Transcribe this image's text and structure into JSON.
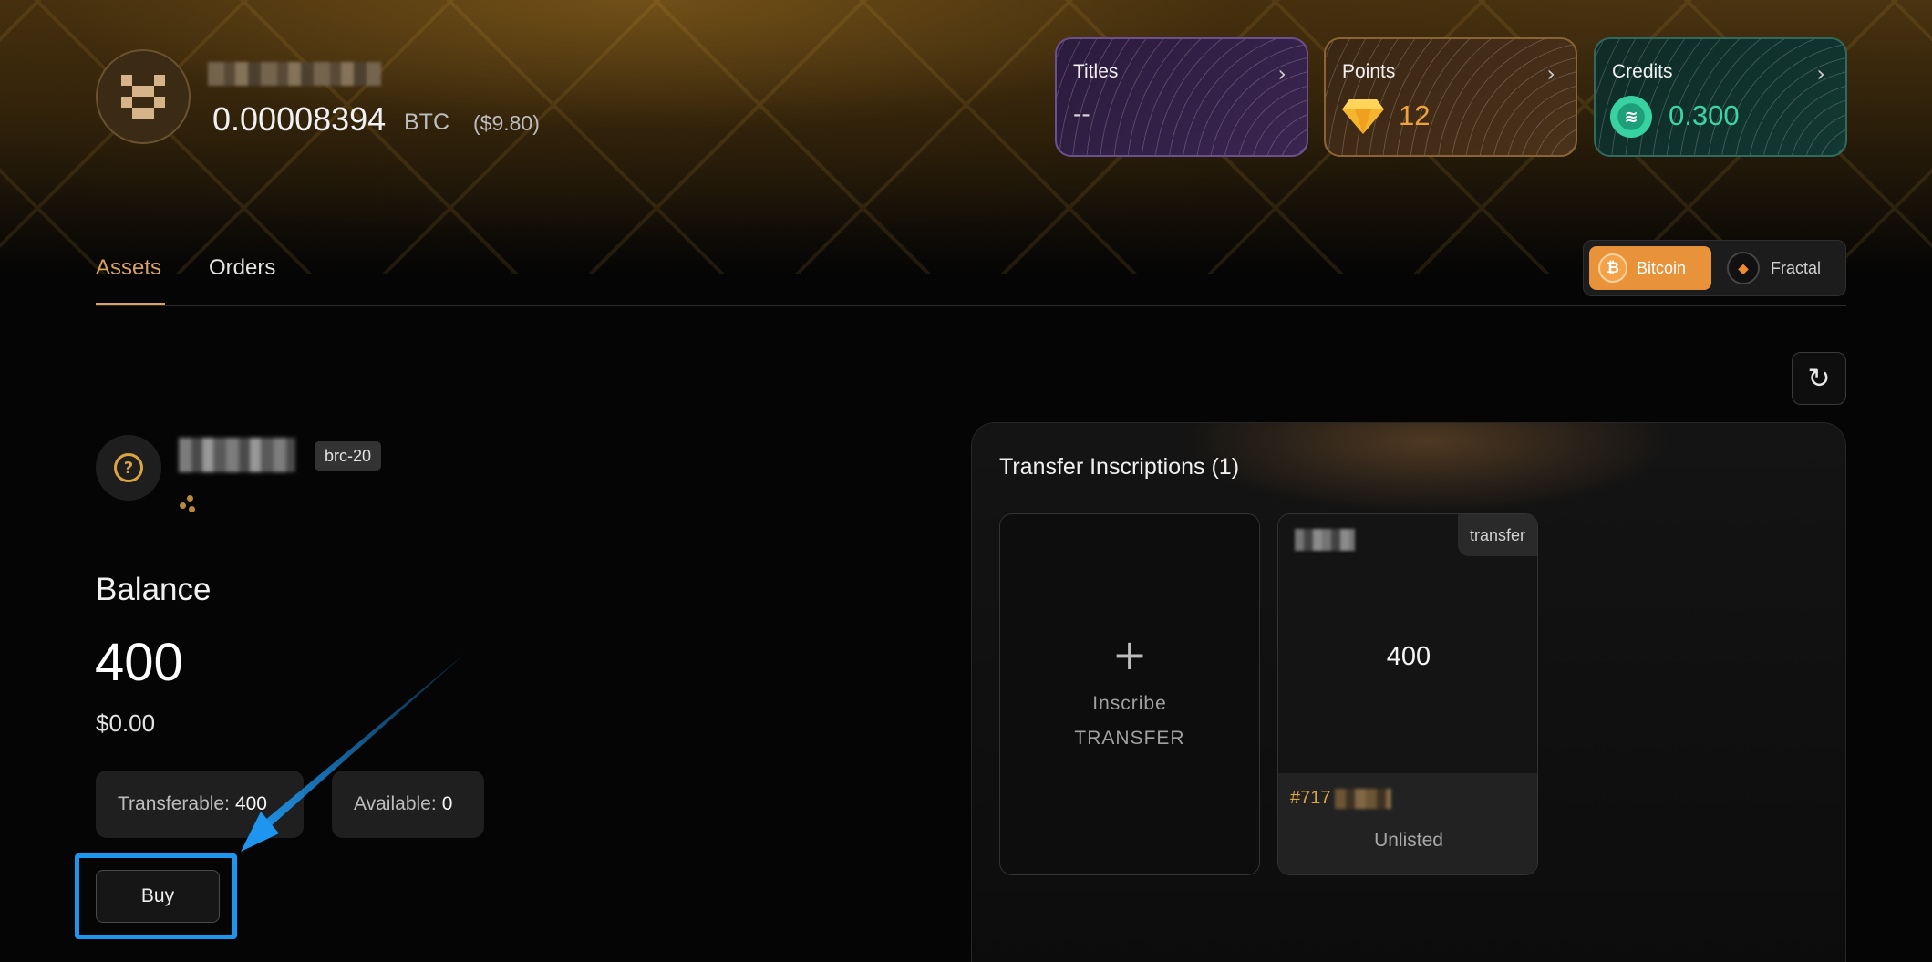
{
  "profile": {
    "btc_amount": "0.00008394",
    "btc_unit": "BTC",
    "usd_value": "($9.80)"
  },
  "stat_cards": {
    "titles": {
      "label": "Titles",
      "value": "--",
      "icon": "chevron-right-icon"
    },
    "points": {
      "label": "Points",
      "value": "12",
      "icon": "diamond-icon"
    },
    "credits": {
      "label": "Credits",
      "value": "0.300",
      "icon": "credit-coin-icon"
    }
  },
  "tabs": [
    {
      "label": "Assets",
      "active": true
    },
    {
      "label": "Orders",
      "active": false
    }
  ],
  "network_switch": {
    "options": [
      {
        "label": "Bitcoin",
        "icon": "bitcoin-icon",
        "active": true,
        "color": "#e8923a"
      },
      {
        "label": "Fractal",
        "icon": "fractal-icon",
        "active": false
      }
    ]
  },
  "token": {
    "badge": "brc-20",
    "balance_label": "Balance",
    "balance_value": "400",
    "balance_usd": "$0.00",
    "transferable_label": "Transferable:",
    "transferable_value": "400",
    "available_label": "Available:",
    "available_value": "0",
    "buy_label": "Buy"
  },
  "inscriptions": {
    "title": "Transfer Inscriptions (1)",
    "inscribe_card": {
      "line1": "Inscribe",
      "line2": "TRANSFER"
    },
    "items": [
      {
        "tag": "transfer",
        "amount": "400",
        "id_prefix": "#717",
        "status": "Unlisted"
      }
    ]
  },
  "colors": {
    "accent": "#d9a35c",
    "highlight_box": "#1e96f0",
    "points": "#f0a33c",
    "credits": "#3ed3a3"
  }
}
